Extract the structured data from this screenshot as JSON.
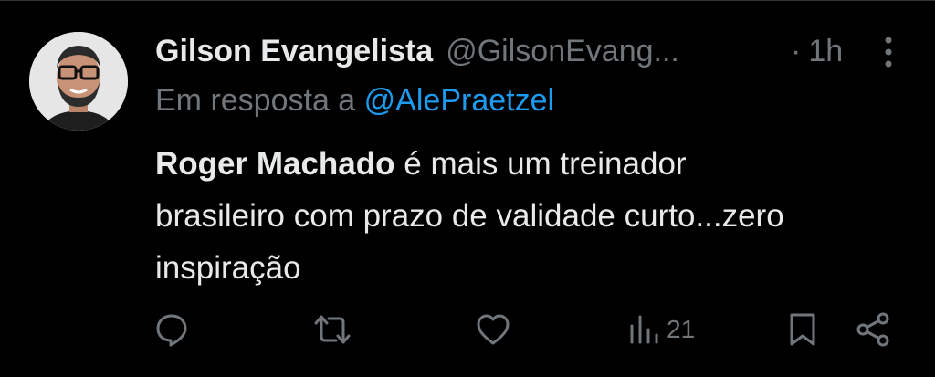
{
  "tweet": {
    "author_name": "Gilson Evangelista",
    "author_handle": "@GilsonEvang...",
    "separator": "·",
    "time": "1h",
    "reply_prefix": "Em resposta a",
    "reply_mention": "@AlePraetzel",
    "body_bold": "Roger Machado",
    "body_line1_rest": " é mais um treinador",
    "body_line2": "brasileiro com prazo de validade curto...zero",
    "body_line3": "inspiração"
  },
  "actions": {
    "views": "21"
  },
  "colors": {
    "background": "#000000",
    "primary_text": "#e7e9ea",
    "secondary_text": "#71767b",
    "link": "#1d9bf0"
  },
  "icons": [
    "reply-icon",
    "retweet-icon",
    "like-icon",
    "views-icon",
    "bookmark-icon",
    "share-icon",
    "more-options-icon"
  ]
}
